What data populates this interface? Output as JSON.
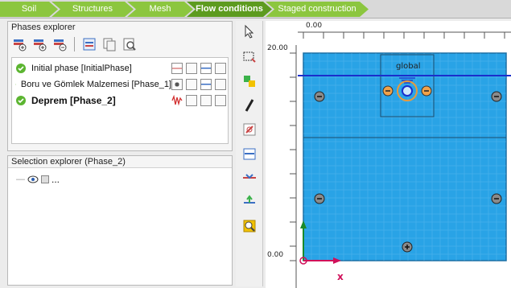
{
  "tabs": [
    {
      "label": "Soil",
      "active": false
    },
    {
      "label": "Structures",
      "active": false
    },
    {
      "label": "Mesh",
      "active": false
    },
    {
      "label": "Flow conditions",
      "active": true
    },
    {
      "label": "Staged construction",
      "active": false
    }
  ],
  "phases_explorer": {
    "title": "Phases explorer",
    "phases": [
      {
        "label": "Initial phase [InitialPhase]"
      },
      {
        "label": "Boru ve Gömlek Malzemesi [Phase_1]"
      },
      {
        "label": "Deprem [Phase_2]"
      }
    ]
  },
  "selection_explorer": {
    "title": "Selection explorer (Phase_2)",
    "item": "..."
  },
  "canvas": {
    "top_ruler_value": "0.00",
    "left_ruler_top_value": "20.00",
    "left_ruler_bottom_value": "0.00",
    "global_label": "global",
    "x_axis_label": "x",
    "soil_color": "#29a3e6",
    "water_line_color": "#1a2ecc"
  },
  "colors": {
    "tab_green": "#8cc63f",
    "tab_active_green": "#5d9b1f"
  }
}
